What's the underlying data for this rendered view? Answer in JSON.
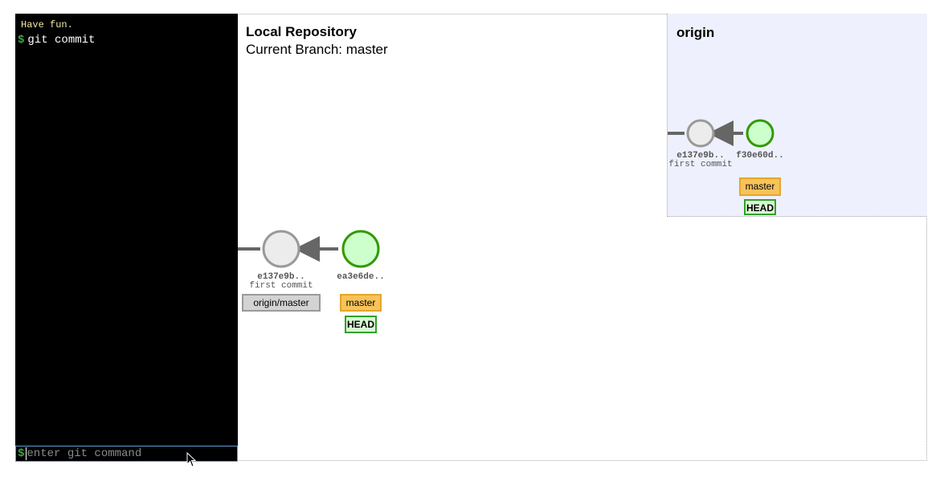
{
  "terminal": {
    "info_text": "Have fun.",
    "prompt_symbol": "$",
    "history": [
      "git commit"
    ],
    "input_placeholder": "enter git command",
    "input_value": ""
  },
  "local_repo": {
    "title": "Local Repository",
    "current_branch": "Current Branch: master",
    "commits": [
      {
        "id": "e137e9b..",
        "message": "first commit",
        "refs": [
          "origin/master"
        ]
      },
      {
        "id": "ea3e6de..",
        "message": "",
        "refs": [
          "master",
          "HEAD"
        ]
      }
    ]
  },
  "origin": {
    "title": "origin",
    "commits": [
      {
        "id": "e137e9b..",
        "message": "first commit",
        "refs": []
      },
      {
        "id": "f30e60d..",
        "message": "",
        "refs": [
          "master",
          "HEAD"
        ]
      }
    ]
  },
  "colors": {
    "terminal_bg": "#000000",
    "prompt": "#3fa83f",
    "info_text": "#f2e9a7",
    "origin_bg": "#eef1fd",
    "commit_old_fill": "#ececec",
    "commit_old_stroke": "#999999",
    "commit_new_fill": "#ccffcc",
    "commit_new_stroke": "#339900",
    "branch_tag": "#f7c35b",
    "remote_tag": "#d3d3d3",
    "head_tag": "#d7f8d3"
  }
}
